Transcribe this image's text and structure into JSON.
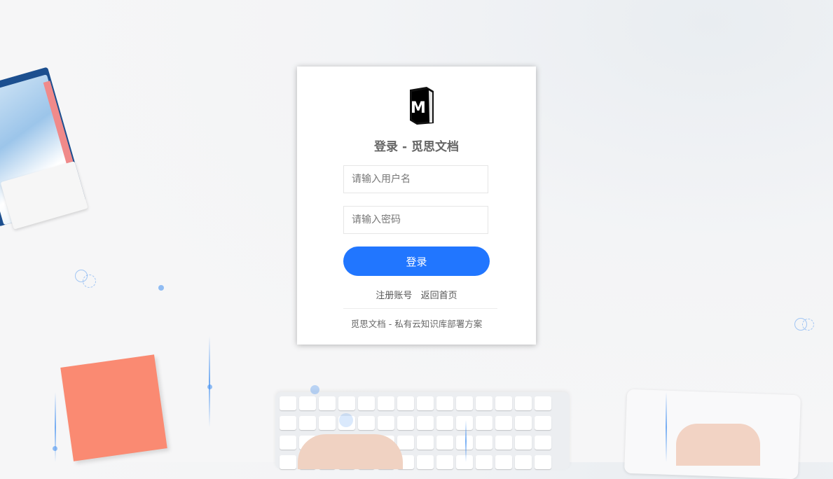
{
  "login": {
    "title": "登录 - 觅思文档",
    "logo_icon": "book-m-logo",
    "logo_letter": "M",
    "username": {
      "placeholder": "请输入用户名",
      "value": ""
    },
    "password": {
      "placeholder": "请输入密码",
      "value": ""
    },
    "submit_label": "登录",
    "links": {
      "register": "注册账号",
      "home": "返回首页"
    },
    "footer": "觅思文档 - 私有云知识库部署方案"
  },
  "colors": {
    "accent": "#2176ff",
    "title": "#666666",
    "card": "#ffffff"
  }
}
